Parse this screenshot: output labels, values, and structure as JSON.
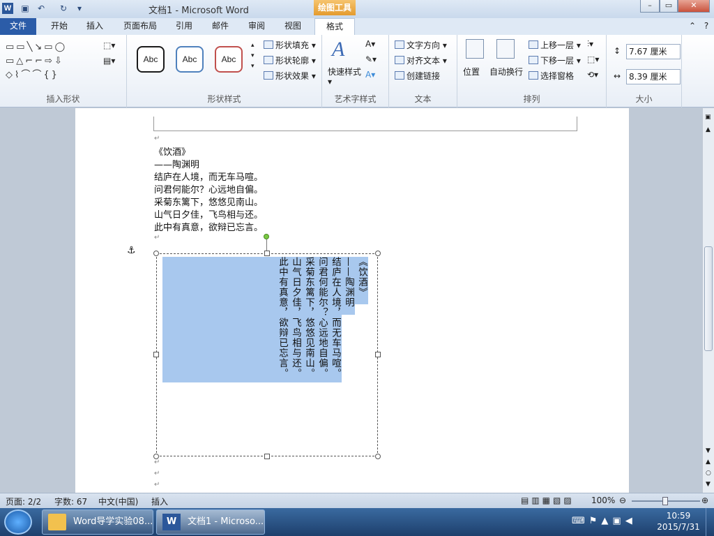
{
  "title_bar": {
    "app_icon": "W",
    "qat_icons": [
      "save-icon",
      "undo-icon",
      "redo-icon",
      "customize-icon"
    ],
    "title": "文档1 - Microsoft Word",
    "contextual_label": "绘图工具",
    "buttons": [
      "minimize-icon",
      "maximize-icon",
      "close-icon"
    ]
  },
  "tabs": [
    "文件",
    "开始",
    "插入",
    "页面布局",
    "引用",
    "邮件",
    "审阅",
    "视图",
    "格式"
  ],
  "ribbon": {
    "insert_shapes": {
      "label": "插入形状"
    },
    "shape_styles": {
      "label": "形状样式",
      "presets": [
        "Abc",
        "Abc",
        "Abc"
      ],
      "preset_colors": [
        "#1a1a1a",
        "#4f81bd",
        "#c0504d"
      ],
      "fill": "形状填充",
      "outline": "形状轮廓",
      "effects": "形状效果"
    },
    "wordart": {
      "label": "艺术字样式",
      "quick": "快速样式"
    },
    "text": {
      "label": "文本",
      "direction": "文字方向",
      "align": "对齐文本",
      "link": "创建链接"
    },
    "arrange": {
      "label": "排列",
      "position": "位置",
      "wrap": "自动换行",
      "bring_forward": "上移一层",
      "send_backward": "下移一层",
      "selection_pane": "选择窗格"
    },
    "size": {
      "label": "大小",
      "height": "7.67 厘米",
      "width": "8.39 厘米"
    }
  },
  "document": {
    "title": "《饮酒》",
    "author": "——陶渊明",
    "lines": [
      "结庐在人境，而无车马喧。",
      "问君何能尔？心远地自偏。",
      "采菊东篱下，悠悠见南山。",
      "山气日夕佳，飞鸟相与还。",
      "此中有真意，欲辩已忘言。"
    ],
    "vertical_columns": [
      "《饮酒》",
      "——陶渊明",
      "结庐在人境，而无车马喧。",
      "问君何能尔？心远地自偏。",
      "采菊东篱下，悠悠见南山。",
      "山气日夕佳，飞鸟相与还。",
      "此中有真意，欲辩已忘言。"
    ],
    "paragraph_mark": "↵"
  },
  "status_bar": {
    "page": "页面: 2/2",
    "words": "字数: 67",
    "language": "中文(中国)",
    "mode": "插入",
    "zoom": "100%"
  },
  "taskbar": {
    "items": [
      "Word导学实验08...",
      "文档1 - Microso..."
    ],
    "time": "10:59",
    "date": "2015/7/31"
  },
  "colors": {
    "accent": "#2b5ca8",
    "selection": "#a8c8ee",
    "contextual": "#e49b2e"
  }
}
